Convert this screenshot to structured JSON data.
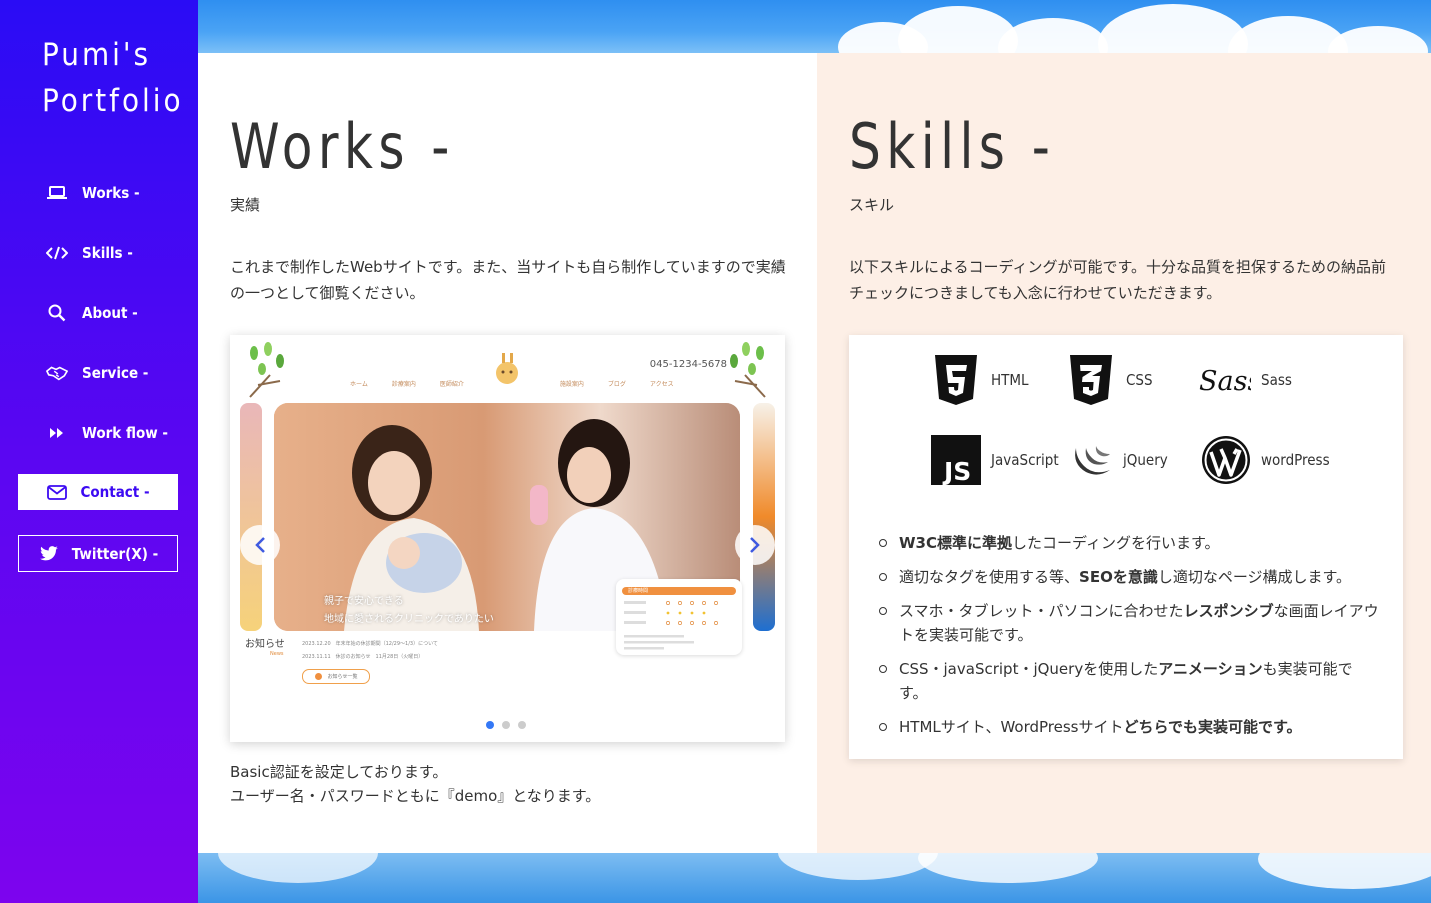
{
  "sidebar": {
    "logo_line1": "Pumi's",
    "logo_line2": "Portfolio",
    "nav": [
      {
        "label": "Works -",
        "icon": "laptop-icon"
      },
      {
        "label": "Skills -",
        "icon": "code-icon"
      },
      {
        "label": "About -",
        "icon": "search-icon"
      },
      {
        "label": "Service -",
        "icon": "handshake-icon"
      },
      {
        "label": "Work flow -",
        "icon": "fast-forward-icon"
      }
    ],
    "contact_label": "Contact -",
    "twitter_label": "Twitter(X) -"
  },
  "works": {
    "title": "Works -",
    "subtitle": "実績",
    "description": "これまで制作したWebサイトです。また、当サイトも自ら制作していますので実績の一つとして御覧ください。",
    "slider": {
      "tel": "045-1234-5678",
      "nav_items": [
        "ホーム",
        "診療案内",
        "医師紹介",
        "",
        "施設案内",
        "ブログ",
        "アクセス"
      ],
      "hero_line1": "親子で安心できる",
      "hero_line2": "地域に愛されるクリニックでありたい",
      "news_title": "お知らせ",
      "news_sub": "News",
      "news_1": "2023.12.20　年末年始の休診期間（12/29～1/3）について",
      "news_2": "2023.11.11　休診のお知らせ　11月28日（火曜日）",
      "news_button": "お知らせ一覧",
      "hours_title": "診療時間",
      "active_slide": 1,
      "slide_count": 3
    },
    "note_line1": "Basic認証を設定しております。",
    "note_line2": "ユーザー名・パスワードともに『demo』となります。"
  },
  "skills": {
    "title": "Skills -",
    "subtitle": "スキル",
    "description": "以下スキルによるコーディングが可能です。十分な品質を担保するための納品前チェックにつきましても入念に行わせていただきます。",
    "items": [
      {
        "label": "HTML",
        "icon": "html5-icon"
      },
      {
        "label": "CSS",
        "icon": "css3-icon"
      },
      {
        "label": "Sass",
        "icon": "sass-icon"
      },
      {
        "label": "JavaScript",
        "icon": "javascript-icon"
      },
      {
        "label": "jQuery",
        "icon": "jquery-icon"
      },
      {
        "label": "wordPress",
        "icon": "wordpress-icon"
      }
    ],
    "points": [
      {
        "bold": "W3C標準に準拠",
        "rest": "したコーディングを行います。"
      },
      {
        "pre": "適切なタグを使用する等、",
        "bold": "SEOを意識",
        "rest": "し適切なページ構成します。"
      },
      {
        "pre": "スマホ・タブレット・パソコンに合わせた",
        "bold": "レスポンシブ",
        "rest": "な画面レイアウトを実装可能です。"
      },
      {
        "pre": "CSS・javaScript・jQueryを使用した",
        "bold": "アニメーション",
        "rest": "も実装可能です。"
      },
      {
        "pre": "HTMLサイト、WordPressサイト",
        "bold": "どちらでも実装可能です。"
      }
    ]
  },
  "colors": {
    "sidebar_top": "#2a0cf5",
    "sidebar_bottom": "#7d04ee",
    "skills_bg": "#fdefe6",
    "sky": "#3b95e6"
  }
}
